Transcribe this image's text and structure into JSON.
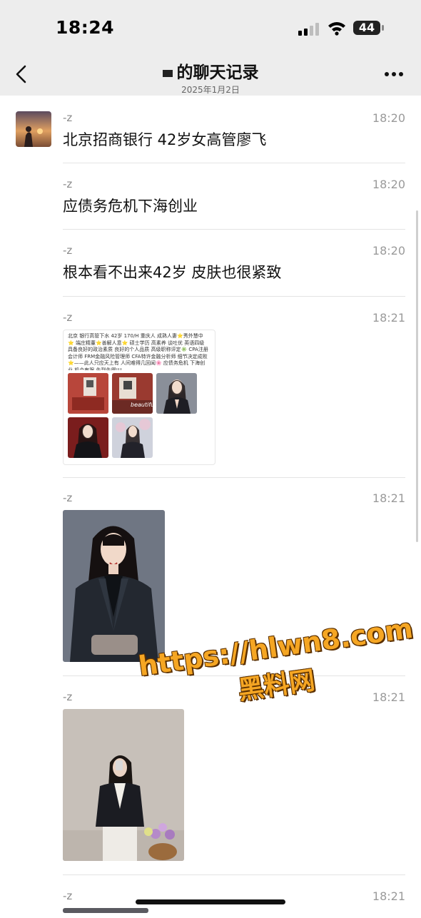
{
  "status_bar": {
    "time": "18:24",
    "battery": "44"
  },
  "nav": {
    "title": "的聊天记录",
    "subtitle": "2025年1月2日"
  },
  "messages": [
    {
      "sender": "-z",
      "time": "18:20",
      "text": "北京招商银行 42岁女高管廖飞"
    },
    {
      "sender": "-z",
      "time": "18:20",
      "text": "应债务危机下海创业"
    },
    {
      "sender": "-z",
      "time": "18:20",
      "text": "根本看不出来42岁 皮肤也很紧致"
    },
    {
      "sender": "-z",
      "time": "18:21",
      "card_text": "北京 银行高管下水 42岁 170/H 重庆人 成熟人妻⭐秀外慧中⭐ 端庄精董⭐善解人意⭐ 硕士学历 高素养 谈吐优 英语四级 具备良好的政治素质 良好的个人品质 高级职称评定✳️ CPA注册会计师 FRM金融风险管理师 CFA特许金融分析师 细节决定成败⭐——此人只应天上有 人间难得几回闻🌸 应债务危机 下海创业 机会有限 先到先得!!!",
      "card_caption": "beautiful"
    },
    {
      "sender": "-z",
      "time": "18:21"
    },
    {
      "sender": "-z",
      "time": "18:21"
    },
    {
      "sender": "-z",
      "time": "18:21"
    }
  ],
  "watermark": {
    "line1": "https://hlwn8.com",
    "line2": "黑料网"
  },
  "colors": {
    "nav_bg": "#ededed",
    "watermark": "#f5a623"
  }
}
